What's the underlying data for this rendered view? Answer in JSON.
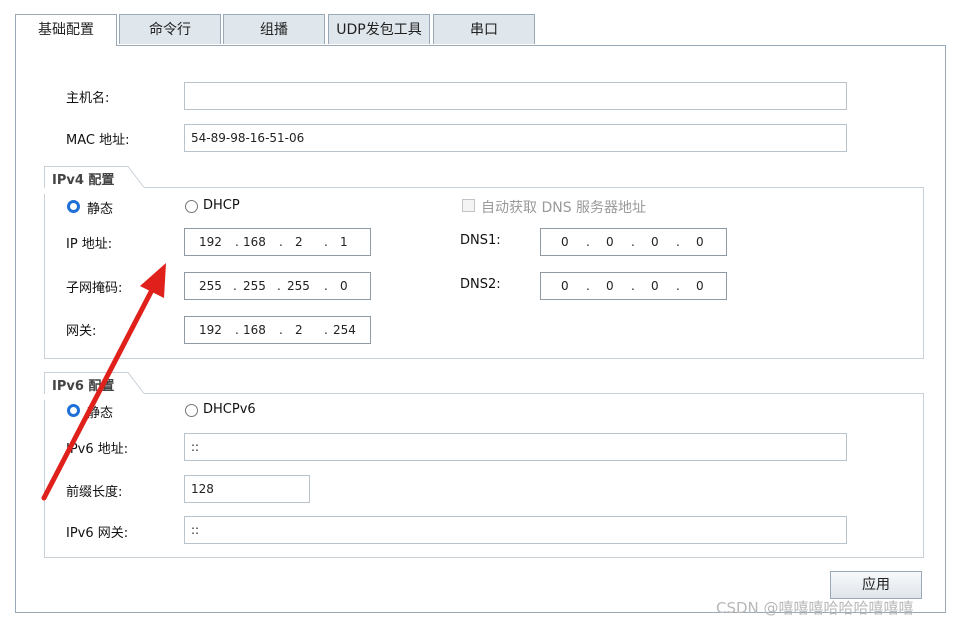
{
  "tabs": [
    "基础配置",
    "命令行",
    "组播",
    "UDP发包工具",
    "串口"
  ],
  "labels": {
    "hostname": "主机名:",
    "mac": "MAC 地址:"
  },
  "fields": {
    "hostname": "",
    "mac": "54-89-98-16-51-06"
  },
  "ipv4": {
    "title": "IPv4 配置",
    "static_label": "静态",
    "dhcp_label": "DHCP",
    "auto_dns_label": "自动获取 DNS 服务器地址",
    "ip_label": "IP 地址:",
    "mask_label": "子网掩码:",
    "gateway_label": "网关:",
    "dns1_label": "DNS1:",
    "dns2_label": "DNS2:",
    "ip": [
      "192",
      "168",
      "2",
      "1"
    ],
    "mask": [
      "255",
      "255",
      "255",
      "0"
    ],
    "gateway": [
      "192",
      "168",
      "2",
      "254"
    ],
    "dns1": [
      "0",
      "0",
      "0",
      "0"
    ],
    "dns2": [
      "0",
      "0",
      "0",
      "0"
    ]
  },
  "ipv6": {
    "title": "IPv6 配置",
    "static_label": "静态",
    "dhcp_label": "DHCPv6",
    "addr_label": "IPv6 地址:",
    "prefix_label": "前缀长度:",
    "gateway_label": "IPv6 网关:",
    "addr": "::",
    "prefix": "128",
    "gateway": "::"
  },
  "apply_label": "应用",
  "watermark": "CSDN @嘻嘻嘻哈哈哈嘻嘻嘻",
  "colors": {
    "annotation_arrow": "#e0201a",
    "radio_selected": "#1e6fd6"
  }
}
